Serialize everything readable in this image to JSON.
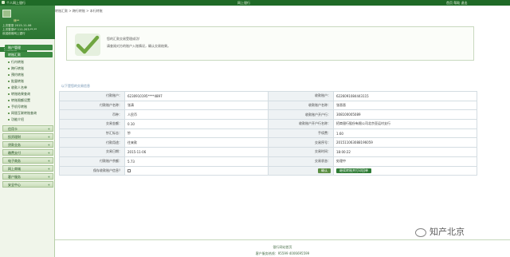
{
  "topbar": {
    "left_text": "个人网上银行",
    "center_text": "网上银行",
    "right_text": "首页  帮助  退出"
  },
  "user": {
    "name": "熊**",
    "line1": "上次登录 2015-11-06",
    "line2": "上次登录IP 111.203.**.**",
    "line3": "欢迎使用网上银行",
    "btn_logout": "安全退出"
  },
  "nav": {
    "account_manage": "账户管理",
    "transfer_head": "转账汇款",
    "items": [
      "行内转账",
      "跨行转账",
      "预约转账",
      "批量转账",
      "收款人名单",
      "转账结果查询",
      "转账限额设置",
      "手机号转账",
      "网银互联转账查询",
      "功能介绍"
    ],
    "groups": [
      "信用卡",
      "投资理财",
      "贷款业务",
      "缴费支付",
      "电子商务",
      "网上商城",
      "客户服务",
      "安全中心"
    ]
  },
  "crumb": "转账汇款 > 跨行转账 > 本行转账",
  "notice": {
    "title": "您的汇款交易受理成功!",
    "desc": "请查阅对方的账户入账情况，确认交易结果。"
  },
  "section_title": "以下是您的交易信息",
  "details": [
    [
      "付款账户：",
      "6230910195****4897",
      "收款账户：",
      "6226091084443115"
    ],
    [
      "付款账户名称：",
      "张清",
      "收款账户名称：",
      "张晋晋"
    ],
    [
      "币种：",
      "人民币",
      "收款账户开户行：",
      "308100005089"
    ],
    [
      "交易金额：",
      "0.10",
      "收款账户开户行名称：",
      "招商银行股份有限公司北京亚运村支行"
    ],
    [
      "钞汇标志：",
      "钞",
      "手续费：",
      "1.60"
    ],
    [
      "付款用途：",
      "往来款",
      "交易序号：",
      "201511063088196059"
    ],
    [
      "交易日期：",
      "2015-11-06",
      "交易时间：",
      "18:00:22"
    ],
    [
      "付款账户余额：",
      "5.73",
      "交易状态：",
      "处理中"
    ]
  ],
  "save_row": {
    "label": "保存收款账户信息？",
    "confirm_btn": "确认",
    "next_btn": "继续转账并打印回单"
  },
  "footer": {
    "bank": "银行网站首页",
    "hotline": "客户服务热线：95599  4006695599"
  },
  "watermark": "知产北京",
  "colors": {
    "brand_green": "#2f7c36",
    "amount_red": "#c0261e"
  }
}
